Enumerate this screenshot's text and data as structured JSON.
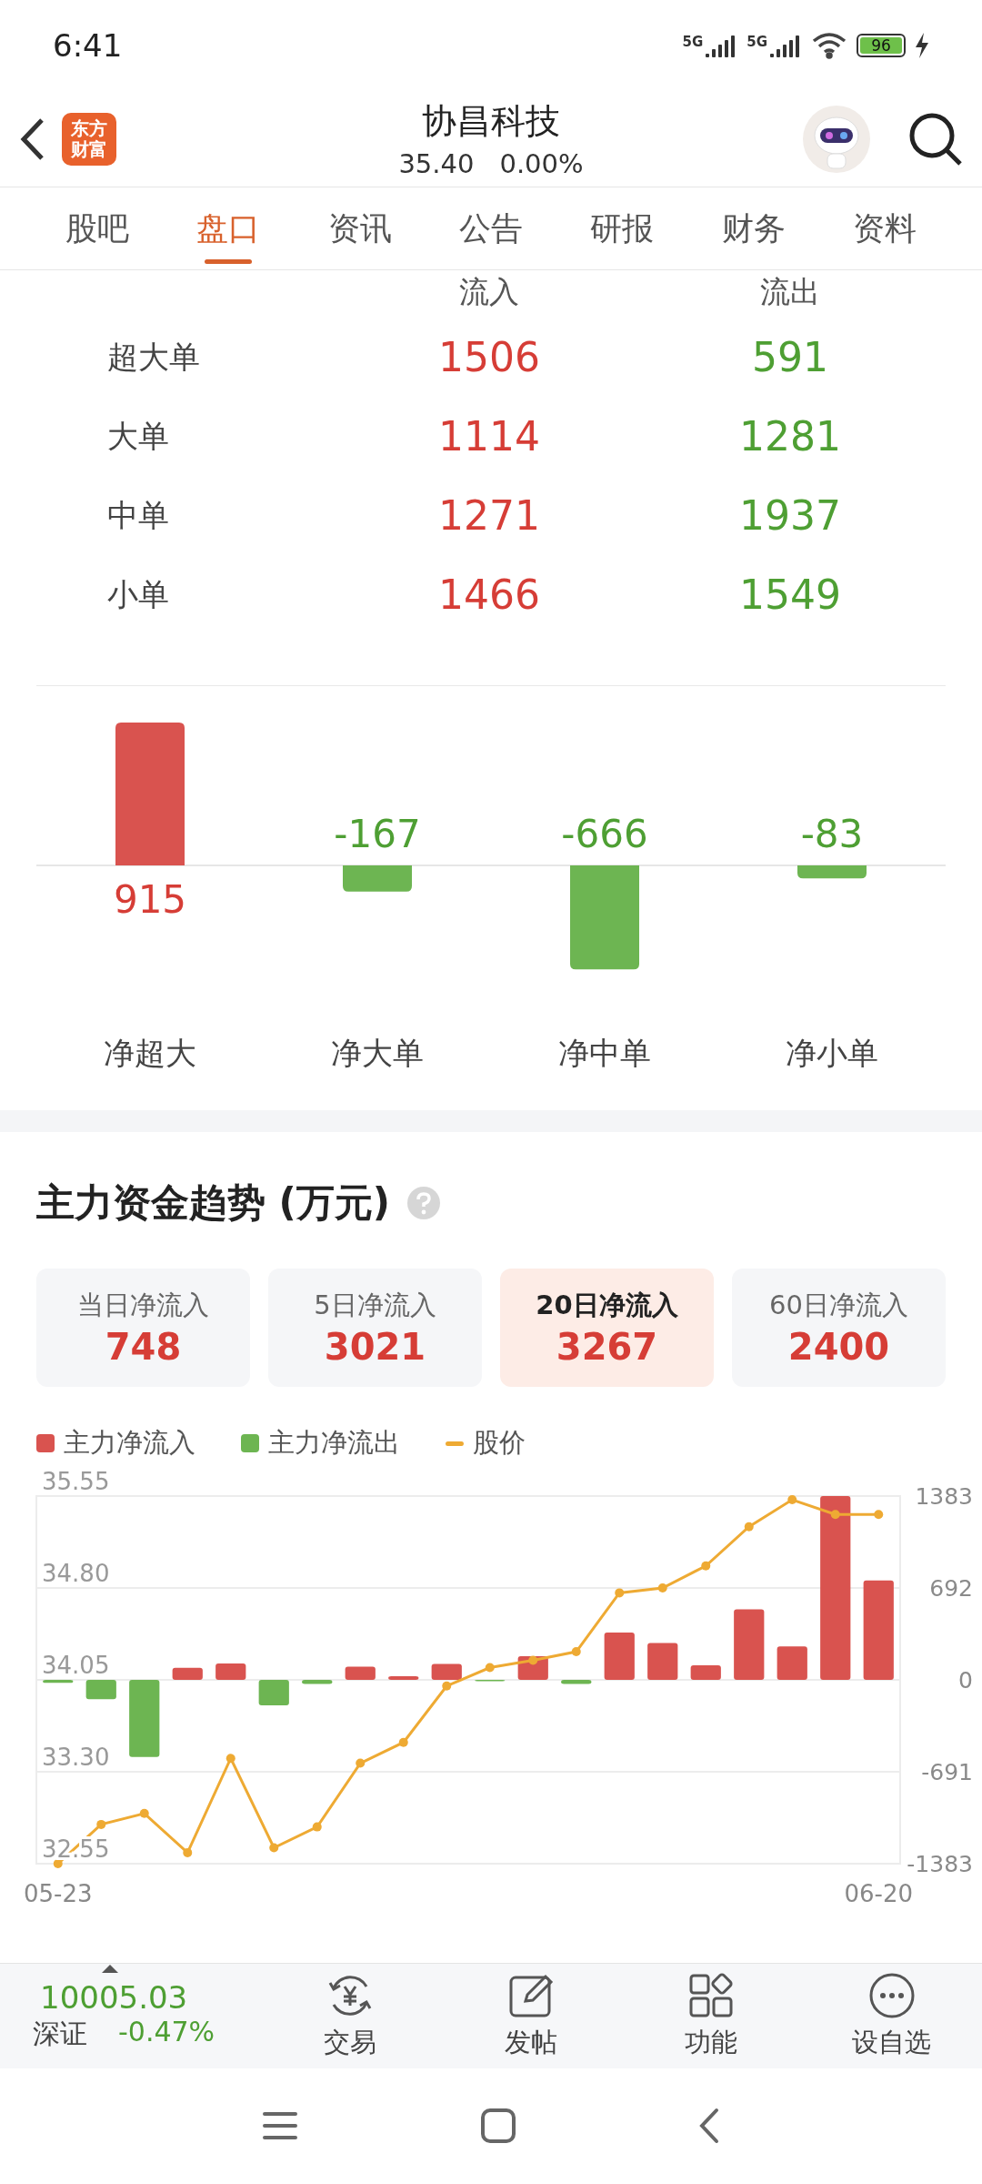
{
  "status_bar": {
    "time": "6:41",
    "network_labels": [
      "5G",
      "5G"
    ],
    "battery": "96"
  },
  "header": {
    "logo_lines": [
      "东方",
      "财富"
    ],
    "title": "协昌科技",
    "price": "35.40",
    "change": "0.00%"
  },
  "tabs": [
    {
      "label": "股吧",
      "selected": false
    },
    {
      "label": "盘口",
      "selected": true
    },
    {
      "label": "资讯",
      "selected": false
    },
    {
      "label": "公告",
      "selected": false
    },
    {
      "label": "研报",
      "selected": false
    },
    {
      "label": "财务",
      "selected": false
    },
    {
      "label": "资料",
      "selected": false
    }
  ],
  "flow_table": {
    "columns": [
      "流入",
      "流出"
    ],
    "rows": [
      {
        "label": "超大单",
        "inflow": "1506",
        "outflow": "591"
      },
      {
        "label": "大单",
        "inflow": "1114",
        "outflow": "1281"
      },
      {
        "label": "中单",
        "inflow": "1271",
        "outflow": "1937"
      },
      {
        "label": "小单",
        "inflow": "1466",
        "outflow": "1549"
      }
    ]
  },
  "net_flow": {
    "chart_data": {
      "type": "bar",
      "categories": [
        "净超大",
        "净大单",
        "净中单",
        "净小单"
      ],
      "values": [
        915,
        -167,
        -666,
        -83
      ],
      "data_labels": true
    }
  },
  "trend": {
    "title": "主力资金趋势 (万元)",
    "cards": [
      {
        "label": "当日净流入",
        "value": "748",
        "selected": false
      },
      {
        "label": "5日净流入",
        "value": "3021",
        "selected": false
      },
      {
        "label": "20日净流入",
        "value": "3267",
        "selected": true
      },
      {
        "label": "60日净流入",
        "value": "2400",
        "selected": false
      }
    ],
    "chart_data": {
      "type": "bar",
      "categories": [
        "05-23",
        null,
        null,
        null,
        null,
        null,
        null,
        null,
        null,
        null,
        null,
        null,
        null,
        null,
        null,
        null,
        null,
        null,
        null,
        "06-20"
      ],
      "series": [
        {
          "name": "主力净流入",
          "color": "#d9534f",
          "axis": "y2",
          "values": [
            null,
            null,
            null,
            91,
            123,
            null,
            null,
            100,
            27,
            119,
            null,
            178,
            null,
            356,
            278,
            110,
            530,
            251,
            1383,
            748
          ]
        },
        {
          "name": "主力净流出",
          "color": "#6db552",
          "axis": "y2",
          "values": [
            -23,
            -146,
            -580,
            null,
            null,
            -192,
            -30,
            null,
            null,
            null,
            -6,
            null,
            -30,
            null,
            null,
            null,
            null,
            null,
            null,
            null
          ]
        },
        {
          "name": "股价",
          "type": "line",
          "marker": "circle",
          "color": "#eeaa33",
          "values": [
            32.55,
            32.87,
            32.96,
            32.64,
            33.41,
            32.68,
            32.85,
            33.37,
            33.54,
            34.0,
            34.15,
            34.21,
            34.28,
            34.76,
            34.8,
            34.98,
            35.3,
            35.52,
            35.4,
            35.4
          ]
        }
      ],
      "grid": true,
      "ylim": [
        32.55,
        35.55
      ],
      "yticks": [
        {
          "value": 35.55,
          "label": "35.55"
        },
        {
          "value": 34.8,
          "label": "34.80"
        },
        {
          "value": 34.05,
          "label": "34.05"
        },
        {
          "value": 33.3,
          "label": "33.30"
        },
        {
          "value": 32.55,
          "label": "32.55"
        }
      ],
      "y2lim": [
        -1383,
        1383
      ],
      "y2ticks": [
        1383,
        692,
        0,
        -691,
        -1383
      ]
    }
  },
  "bottom_bar": {
    "index_value": "10005.03",
    "index_name": "深证",
    "index_change": "-0.47%",
    "actions": [
      {
        "label": "交易",
        "kind": "trade"
      },
      {
        "label": "发帖",
        "kind": "post"
      },
      {
        "label": "功能",
        "kind": "apps"
      },
      {
        "label": "设自选",
        "kind": "more"
      }
    ]
  }
}
